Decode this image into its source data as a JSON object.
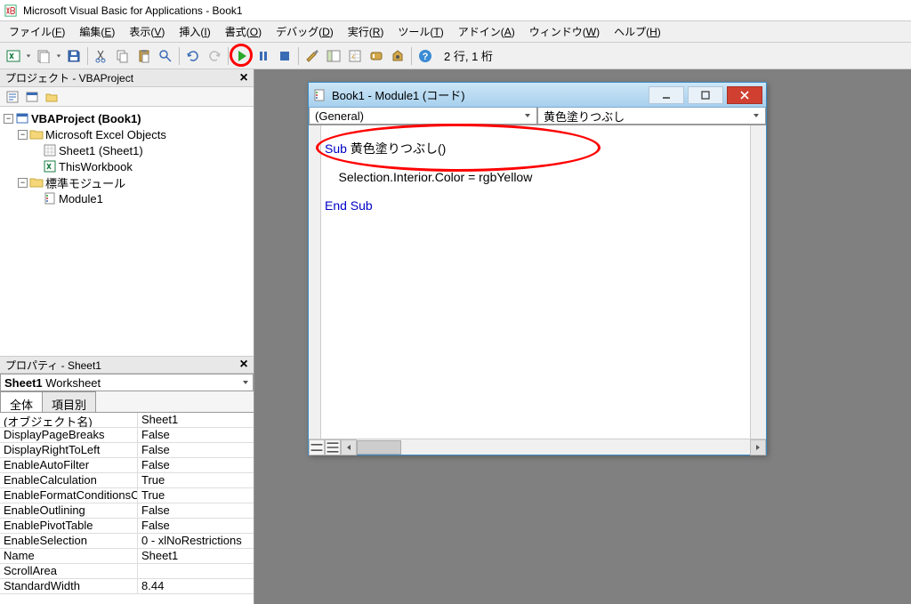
{
  "app": {
    "title": "Microsoft Visual Basic for Applications - Book1"
  },
  "menu": [
    {
      "label": "ファイル",
      "u": "F"
    },
    {
      "label": "編集",
      "u": "E"
    },
    {
      "label": "表示",
      "u": "V"
    },
    {
      "label": "挿入",
      "u": "I"
    },
    {
      "label": "書式",
      "u": "O"
    },
    {
      "label": "デバッグ",
      "u": "D"
    },
    {
      "label": "実行",
      "u": "R"
    },
    {
      "label": "ツール",
      "u": "T"
    },
    {
      "label": "アドイン",
      "u": "A"
    },
    {
      "label": "ウィンドウ",
      "u": "W"
    },
    {
      "label": "ヘルプ",
      "u": "H"
    }
  ],
  "status_pos": "2 行, 1 桁",
  "project_panel": {
    "title": "プロジェクト - VBAProject",
    "tree": {
      "root": "VBAProject (Book1)",
      "excel_objects": "Microsoft Excel Objects",
      "sheet1": "Sheet1 (Sheet1)",
      "thisworkbook": "ThisWorkbook",
      "modules": "標準モジュール",
      "module1": "Module1"
    }
  },
  "properties_panel": {
    "title": "プロパティ - Sheet1",
    "selector": "Sheet1 Worksheet",
    "tabs": {
      "all": "全体",
      "cat": "項目別"
    },
    "rows": [
      {
        "name": "(オブジェクト名)",
        "value": "Sheet1"
      },
      {
        "name": "DisplayPageBreaks",
        "value": "False"
      },
      {
        "name": "DisplayRightToLeft",
        "value": "False"
      },
      {
        "name": "EnableAutoFilter",
        "value": "False"
      },
      {
        "name": "EnableCalculation",
        "value": "True"
      },
      {
        "name": "EnableFormatConditionsCalculation",
        "value": "True"
      },
      {
        "name": "EnableOutlining",
        "value": "False"
      },
      {
        "name": "EnablePivotTable",
        "value": "False"
      },
      {
        "name": "EnableSelection",
        "value": "0 - xlNoRestrictions"
      },
      {
        "name": "Name",
        "value": "Sheet1"
      },
      {
        "name": "ScrollArea",
        "value": ""
      },
      {
        "name": "StandardWidth",
        "value": "8.44"
      }
    ]
  },
  "code_window": {
    "title": "Book1 - Module1 (コード)",
    "left_sel": "(General)",
    "right_sel": "黄色塗りつぶし",
    "line1_kw": "Sub",
    "line1_rest": " 黄色塗りつぶし()",
    "line2": "    Selection.Interior.Color = rgbYellow",
    "line3": "End Sub"
  }
}
